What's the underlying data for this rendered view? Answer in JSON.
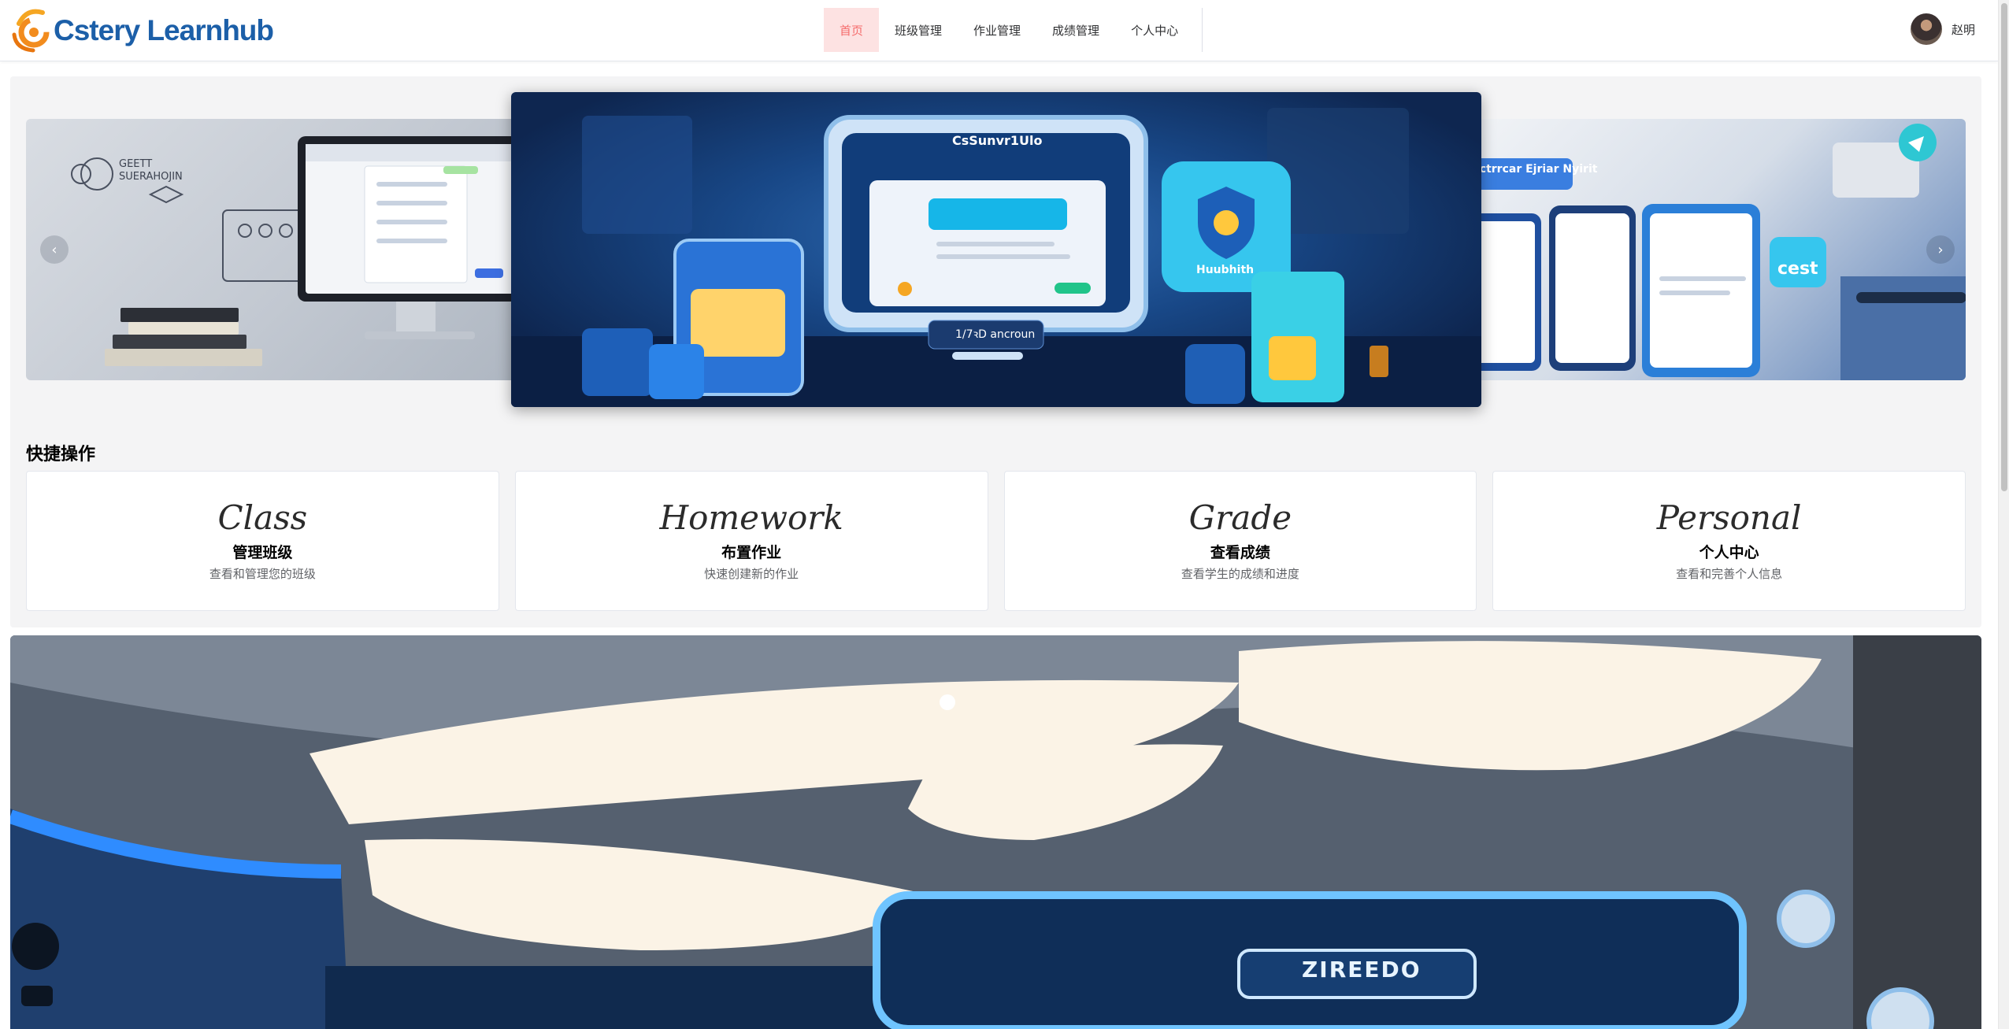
{
  "header": {
    "logo_text": "Cstery Learnhub",
    "nav": [
      {
        "label": "首页",
        "active": true
      },
      {
        "label": "班级管理",
        "active": false
      },
      {
        "label": "作业管理",
        "active": false
      },
      {
        "label": "成绩管理",
        "active": false
      },
      {
        "label": "个人中心",
        "active": false
      }
    ],
    "user_name": "赵明"
  },
  "carousel": {
    "center_title": "CsSunvr1Ulo",
    "center_caption": "1/7ꝛD ancroun",
    "left_caption": "GEETT SUERAHOJIN",
    "right_caption": "ctictrrcar Ejriar Nyirit",
    "right_badge": "cest",
    "center_badge": "Huubhith",
    "prev_icon": "chevron-left-icon",
    "next_icon": "chevron-right-icon"
  },
  "quick_actions": {
    "title": "快捷操作",
    "items": [
      {
        "big": "Class",
        "name": "管理班级",
        "desc": "查看和管理您的班级"
      },
      {
        "big": "Homework",
        "name": "布置作业",
        "desc": "快速创建新的作业"
      },
      {
        "big": "Grade",
        "name": "查看成绩",
        "desc": "查看学生的成绩和进度"
      },
      {
        "big": "Personal",
        "name": "个人中心",
        "desc": "查看和完善个人信息"
      }
    ]
  },
  "banner": {
    "sign_text": "ZIREEDO"
  },
  "colors": {
    "brand": "#1c5fa8",
    "logo_orange": "#f28c1e",
    "nav_active_bg": "#fde2e2",
    "nav_active_text": "#f56c6c"
  }
}
